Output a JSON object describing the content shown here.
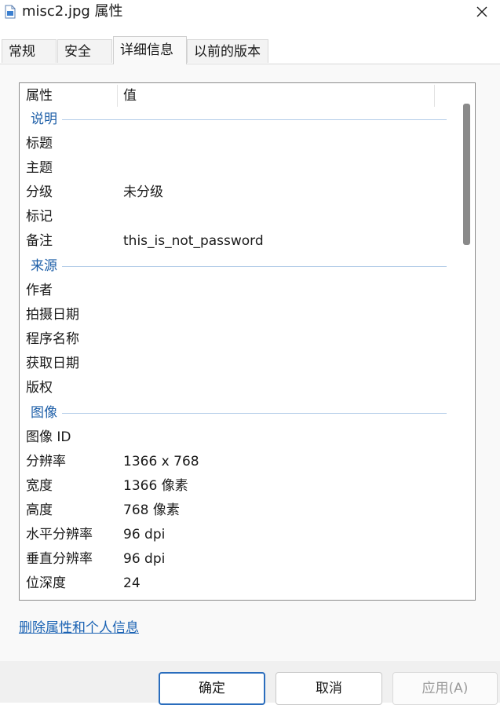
{
  "window": {
    "title": "misc2.jpg 属性"
  },
  "tabs": [
    {
      "label": "常规"
    },
    {
      "label": "安全"
    },
    {
      "label": "详细信息",
      "active": true
    },
    {
      "label": "以前的版本"
    }
  ],
  "table": {
    "col_property": "属性",
    "col_value": "值",
    "groups": [
      {
        "name": "说明",
        "rows": [
          {
            "key": "标题",
            "value": ""
          },
          {
            "key": "主题",
            "value": ""
          },
          {
            "key": "分级",
            "value": "未分级"
          },
          {
            "key": "标记",
            "value": ""
          },
          {
            "key": "备注",
            "value": "this_is_not_password"
          }
        ]
      },
      {
        "name": "来源",
        "rows": [
          {
            "key": "作者",
            "value": ""
          },
          {
            "key": "拍摄日期",
            "value": ""
          },
          {
            "key": "程序名称",
            "value": ""
          },
          {
            "key": "获取日期",
            "value": ""
          },
          {
            "key": "版权",
            "value": ""
          }
        ]
      },
      {
        "name": "图像",
        "rows": [
          {
            "key": "图像 ID",
            "value": ""
          },
          {
            "key": "分辨率",
            "value": "1366 x 768"
          },
          {
            "key": "宽度",
            "value": "1366 像素"
          },
          {
            "key": "高度",
            "value": "768 像素"
          },
          {
            "key": "水平分辨率",
            "value": "96 dpi"
          },
          {
            "key": "垂直分辨率",
            "value": "96 dpi"
          },
          {
            "key": "位深度",
            "value": "24"
          }
        ]
      }
    ]
  },
  "remove_link": "删除属性和个人信息",
  "buttons": {
    "ok": "确定",
    "cancel": "取消",
    "apply": "应用(A)"
  },
  "colors": {
    "accent": "#1e5fa8",
    "link": "#1a62b3"
  },
  "icons": {
    "file": "image-file-icon",
    "close": "close-icon"
  }
}
